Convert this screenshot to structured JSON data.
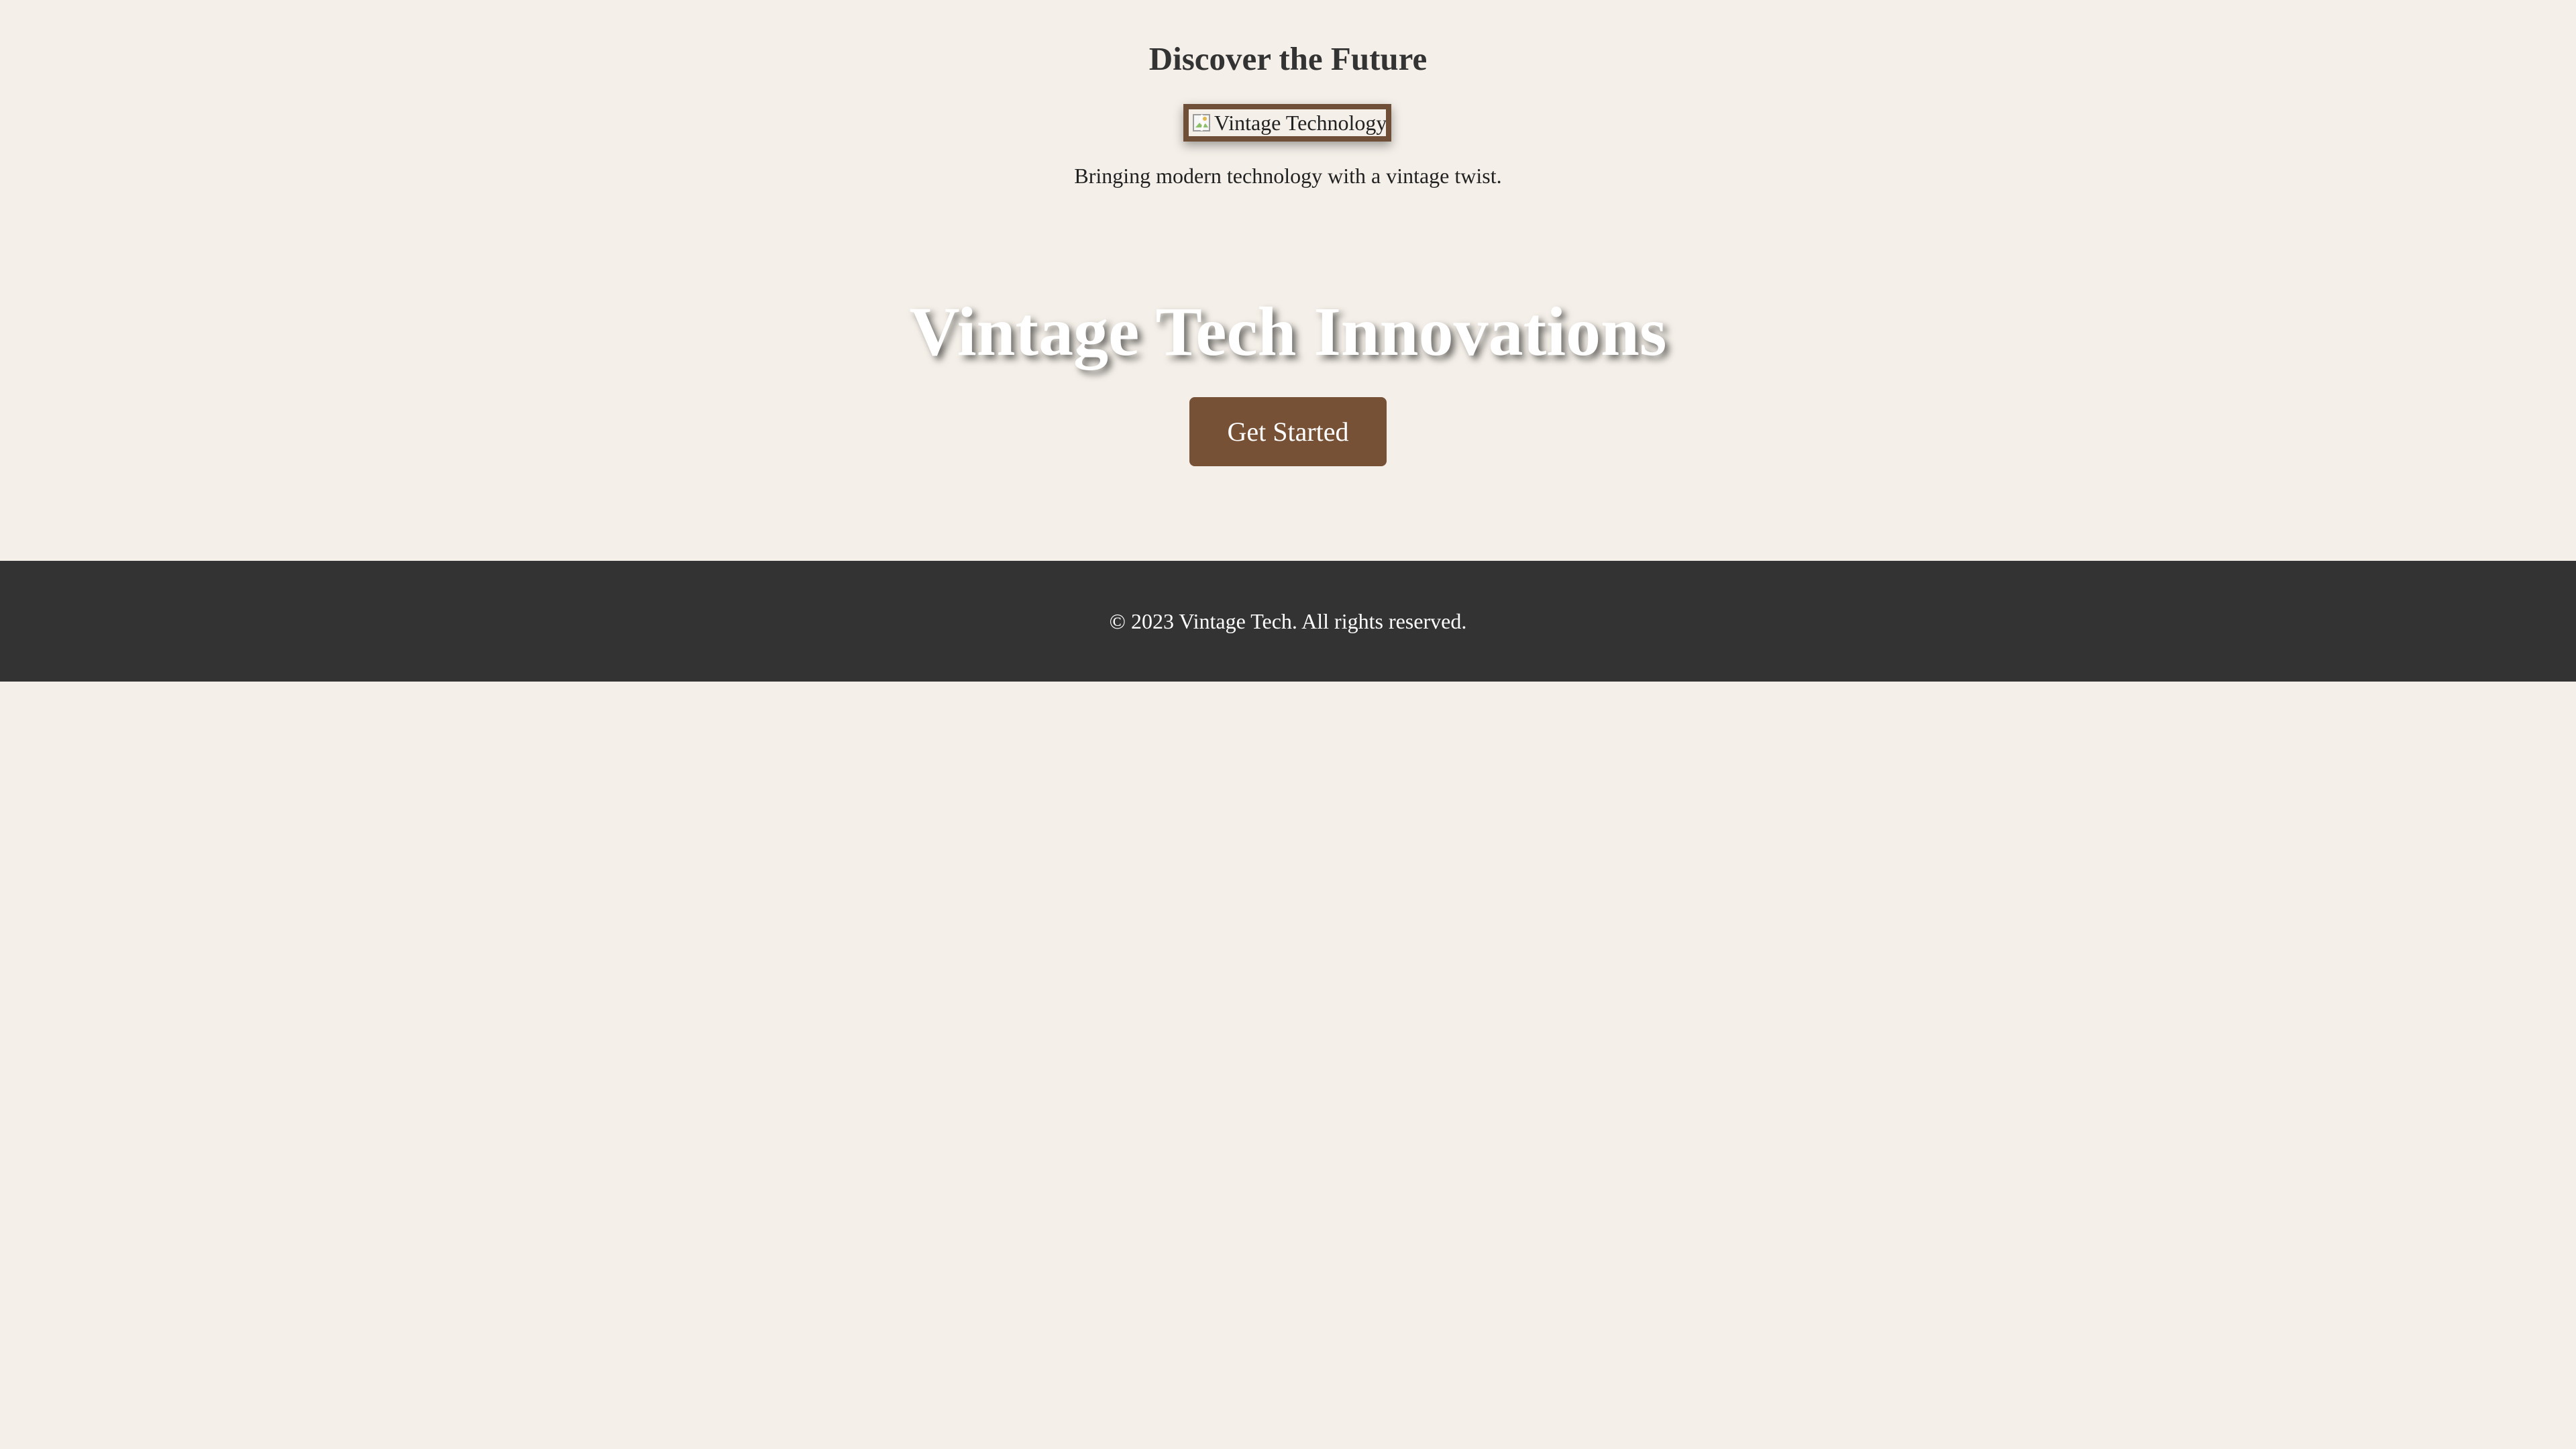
{
  "intro": {
    "title": "Discover the Future",
    "image_alt": "Vintage Technology",
    "description": "Bringing modern technology with a vintage twist."
  },
  "hero": {
    "title": "Vintage Tech Innovations",
    "cta_label": "Get Started"
  },
  "footer": {
    "copyright": "© 2023 Vintage Tech. All rights reserved."
  },
  "icons": {
    "broken_image": "broken-image-icon"
  },
  "colors": {
    "background": "#f4efe8",
    "accent_brown": "#775136",
    "frame_brown": "#6f4f37",
    "dark_text": "#333333",
    "footer_background": "#333333",
    "white": "#ffffff"
  }
}
